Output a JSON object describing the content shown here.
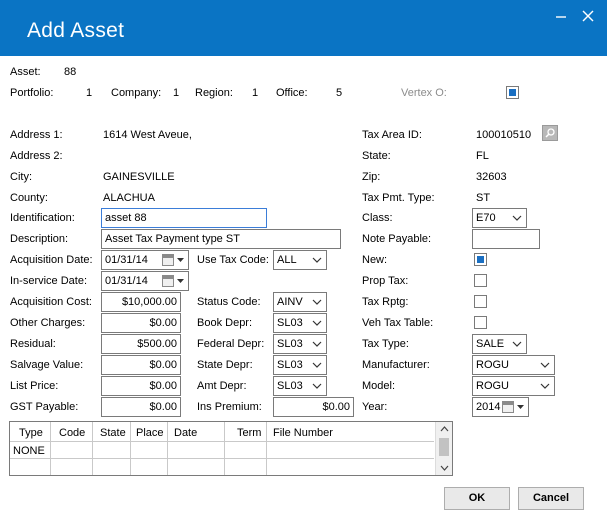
{
  "dialog": {
    "title": "Add Asset"
  },
  "header": {
    "asset_label": "Asset:",
    "asset_value": "88",
    "portfolio_label": "Portfolio:",
    "portfolio_value": "1",
    "company_label": "Company:",
    "company_value": "1",
    "region_label": "Region:",
    "region_value": "1",
    "office_label": "Office:",
    "office_value": "5",
    "vertex_label": "Vertex O:",
    "vertex_checked": true
  },
  "left": {
    "address1_label": "Address 1:",
    "address1_value": "1614 West Aveue,",
    "address2_label": "Address 2:",
    "address2_value": "",
    "city_label": "City:",
    "city_value": "GAINESVILLE",
    "county_label": "County:",
    "county_value": "ALACHUA",
    "identification_label": "Identification:",
    "identification_value": "asset 88",
    "description_label": "Description:",
    "description_value": "Asset Tax Payment type ST",
    "acq_date_label": "Acquisition Date:",
    "acq_date_value": "01/31/14",
    "inservice_date_label": "In-service Date:",
    "inservice_date_value": "01/31/14",
    "acq_cost_label": "Acquisition Cost:",
    "acq_cost_value": "$10,000.00",
    "other_charges_label": "Other Charges:",
    "other_charges_value": "$0.00",
    "residual_label": "Residual:",
    "residual_value": "$500.00",
    "salvage_label": "Salvage Value:",
    "salvage_value": "$0.00",
    "list_price_label": "List Price:",
    "list_price_value": "$0.00",
    "gst_label": "GST Payable:",
    "gst_value": "$0.00"
  },
  "middle": {
    "use_tax_label": "Use Tax Code:",
    "use_tax_value": "ALL",
    "status_label": "Status Code:",
    "status_value": "AINV",
    "book_label": "Book Depr:",
    "book_value": "SL03",
    "federal_label": "Federal Depr:",
    "federal_value": "SL03",
    "state_label": "State Depr:",
    "state_value": "SL03",
    "amt_label": "Amt Depr:",
    "amt_value": "SL03",
    "ins_label": "Ins Premium:",
    "ins_value": "$0.00"
  },
  "right": {
    "tax_area_label": "Tax Area ID:",
    "tax_area_value": "100010510",
    "state_label": "State:",
    "state_value": "FL",
    "zip_label": "Zip:",
    "zip_value": "32603",
    "tax_pmt_label": "Tax Pmt. Type:",
    "tax_pmt_value": "ST",
    "class_label": "Class:",
    "class_value": "E70",
    "note_label": "Note Payable:",
    "note_value": "",
    "new_label": "New:",
    "new_checked": true,
    "prop_tax_label": "Prop Tax:",
    "prop_tax_checked": false,
    "tax_rptg_label": "Tax Rptg:",
    "tax_rptg_checked": false,
    "veh_tax_label": "Veh Tax Table:",
    "veh_tax_checked": false,
    "tax_type_label": "Tax Type:",
    "tax_type_value": "SALE",
    "manufacturer_label": "Manufacturer:",
    "manufacturer_value": "ROGU",
    "model_label": "Model:",
    "model_value": "ROGU",
    "year_label": "Year:",
    "year_value": "2014"
  },
  "table": {
    "columns": [
      "Type",
      "Code",
      "State",
      "Place",
      "Date",
      "Term",
      "File Number"
    ],
    "rows": [
      [
        "NONE",
        "",
        "",
        "",
        "",
        "",
        ""
      ]
    ]
  },
  "buttons": {
    "ok": "OK",
    "cancel": "Cancel"
  },
  "colors": {
    "titlebar": "#0a74c4",
    "check": "#1a6fc2"
  }
}
